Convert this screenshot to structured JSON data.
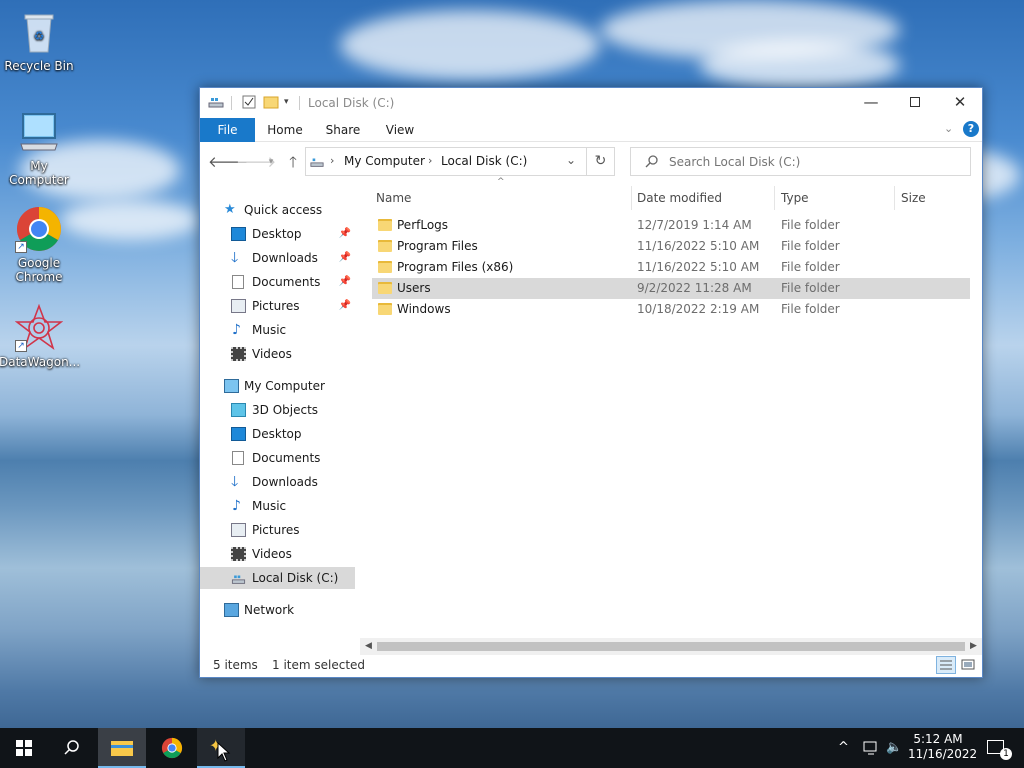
{
  "desktop": {
    "icons": [
      {
        "label": "Recycle Bin"
      },
      {
        "label": "My Computer"
      },
      {
        "label": "Google Chrome"
      },
      {
        "label": "DataWagon..."
      }
    ]
  },
  "window": {
    "title": "Local Disk (C:)",
    "ribbon_tabs": [
      "File",
      "Home",
      "Share",
      "View"
    ],
    "breadcrumb": [
      "My Computer",
      "Local Disk (C:)"
    ],
    "search_placeholder": "Search Local Disk (C:)",
    "nav_pane": {
      "quick_access": "Quick access",
      "quick_items": [
        "Desktop",
        "Downloads",
        "Documents",
        "Pictures",
        "Music",
        "Videos"
      ],
      "my_computer": "My Computer",
      "computer_items": [
        "3D Objects",
        "Desktop",
        "Documents",
        "Downloads",
        "Music",
        "Pictures",
        "Videos",
        "Local Disk (C:)"
      ],
      "network": "Network"
    },
    "columns": [
      "Name",
      "Date modified",
      "Type",
      "Size"
    ],
    "files": [
      {
        "name": "PerfLogs",
        "date": "12/7/2019 1:14 AM",
        "type": "File folder",
        "selected": false
      },
      {
        "name": "Program Files",
        "date": "11/16/2022 5:10 AM",
        "type": "File folder",
        "selected": false
      },
      {
        "name": "Program Files (x86)",
        "date": "11/16/2022 5:10 AM",
        "type": "File folder",
        "selected": false
      },
      {
        "name": "Users",
        "date": "9/2/2022 11:28 AM",
        "type": "File folder",
        "selected": true
      },
      {
        "name": "Windows",
        "date": "10/18/2022 2:19 AM",
        "type": "File folder",
        "selected": false
      }
    ],
    "status": {
      "count": "5 items",
      "selection": "1 item selected"
    }
  },
  "taskbar": {
    "time": "5:12 AM",
    "date": "11/16/2022",
    "notification_count": "1"
  },
  "colors": {
    "accent": "#1979ca",
    "selection": "#d9d9d9",
    "folder": "#f8d775"
  }
}
